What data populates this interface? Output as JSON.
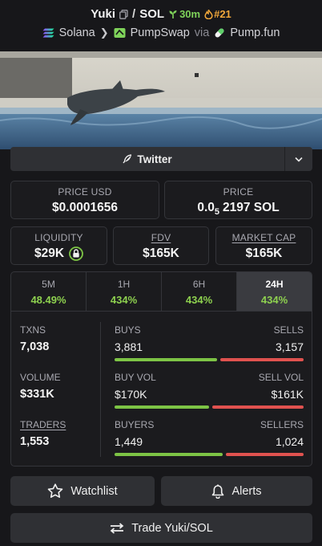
{
  "header": {
    "token": "Yuki",
    "quote": "SOL",
    "age": "30m",
    "rank": "#21",
    "chain": "Solana",
    "dex": "PumpSwap",
    "via": "via",
    "launchpad": "Pump.fun"
  },
  "social": {
    "label": "Twitter"
  },
  "price": {
    "usd_label": "PRICE USD",
    "usd_value": "$0.0001656",
    "native_label": "PRICE",
    "native_prefix": "0.0",
    "native_zeros": "5",
    "native_digits": "2197 SOL"
  },
  "liquidity": {
    "label": "LIQUIDITY",
    "value": "$29K"
  },
  "fdv": {
    "label": "FDV",
    "value": "$165K"
  },
  "market_cap": {
    "label": "MARKET CAP",
    "value": "$165K"
  },
  "tabs": [
    {
      "label": "5M",
      "value": "48.49%"
    },
    {
      "label": "1H",
      "value": "434%"
    },
    {
      "label": "6H",
      "value": "434%"
    },
    {
      "label": "24H",
      "value": "434%",
      "active": true
    }
  ],
  "metrics": {
    "txns": {
      "label": "TXNS",
      "value": "7,038"
    },
    "volume": {
      "label": "VOLUME",
      "value": "$331K"
    },
    "traders": {
      "label": "TRADERS",
      "value": "1,553"
    }
  },
  "splits": {
    "buys": {
      "left_label": "BUYS",
      "right_label": "SELLS",
      "left_value": "3,881",
      "right_value": "3,157",
      "buy_fraction": 0.55
    },
    "vol": {
      "left_label": "BUY VOL",
      "right_label": "SELL VOL",
      "left_value": "$170K",
      "right_value": "$161K",
      "buy_fraction": 0.51
    },
    "buyers": {
      "left_label": "BUYERS",
      "right_label": "SELLERS",
      "left_value": "1,449",
      "right_value": "1,024",
      "buy_fraction": 0.58
    }
  },
  "actions": {
    "watchlist": "Watchlist",
    "alerts": "Alerts",
    "trade": "Trade Yuki/SOL"
  },
  "colors": {
    "green": "#7dc445",
    "red": "#e0524f",
    "age_green": "#7fd35a",
    "rank_orange": "#f2a83b"
  }
}
